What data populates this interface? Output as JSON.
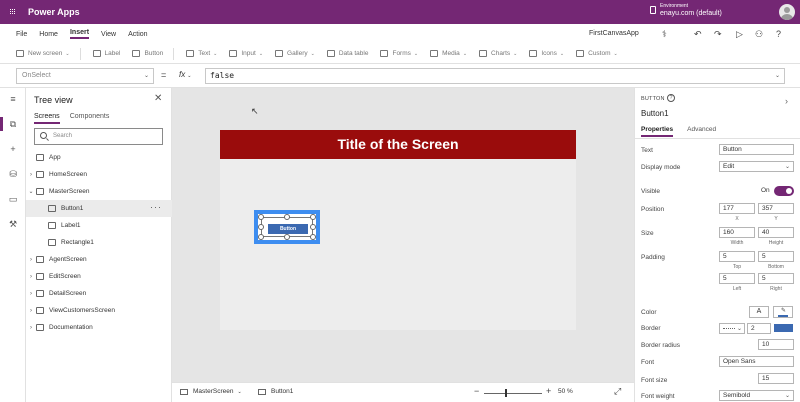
{
  "app": {
    "title": "Power Apps",
    "environment_label": "Environment",
    "environment_value": "enayu.com (default)"
  },
  "menu": {
    "items": [
      "File",
      "Home",
      "Insert",
      "View",
      "Action"
    ],
    "active": "Insert",
    "app_name": "FirstCanvasApp"
  },
  "ribbon": {
    "new_screen": "New screen",
    "label": "Label",
    "button": "Button",
    "text": "Text",
    "input": "Input",
    "gallery": "Gallery",
    "data_table": "Data table",
    "forms": "Forms",
    "media": "Media",
    "charts": "Charts",
    "icons": "Icons",
    "custom": "Custom"
  },
  "formula": {
    "property": "OnSelect",
    "equals": "=",
    "fx": "fx",
    "value": "false"
  },
  "tree": {
    "title": "Tree view",
    "tabs": [
      "Screens",
      "Components"
    ],
    "search_placeholder": "Search",
    "app": "App",
    "home_screen": "HomeScreen",
    "master_screen": "MasterScreen",
    "button1": "Button1",
    "label1": "Label1",
    "rectangle1": "Rectangle1",
    "agent_screen": "AgentScreen",
    "edit_screen": "EditScreen",
    "detail_screen": "DetailScreen",
    "view_customers_screen": "ViewCustomersScreen",
    "documentation": "Documentation"
  },
  "canvas": {
    "screen_title": "Title of the Screen",
    "button_text": "Button"
  },
  "statusbar": {
    "screen": "MasterScreen",
    "control": "Button1",
    "zoom_minus": "−",
    "zoom_plus": "+",
    "zoom": "50 %",
    "zoom_fraction": 0.5
  },
  "properties": {
    "type": "BUTTON",
    "name": "Button1",
    "tabs": [
      "Properties",
      "Advanced"
    ],
    "text_label": "Text",
    "text_value": "Button",
    "display_mode_label": "Display mode",
    "display_mode_value": "Edit",
    "visible_label": "Visible",
    "visible_value": "On",
    "position_label": "Position",
    "x": "177",
    "y": "357",
    "x_label": "X",
    "y_label": "Y",
    "size_label": "Size",
    "width": "160",
    "height": "40",
    "width_label": "Width",
    "height_label": "Height",
    "padding_label": "Padding",
    "pad_top": "5",
    "pad_bottom": "5",
    "pad_left": "5",
    "pad_right": "5",
    "top_label": "Top",
    "bottom_label": "Bottom",
    "left_label": "Left",
    "right_label": "Right",
    "color_label": "Color",
    "color_a": "A",
    "border_label": "Border",
    "border_width": "2",
    "border_color": "#3b69b1",
    "border_radius_label": "Border radius",
    "border_radius": "10",
    "font_label": "Font",
    "font_value": "Open Sans",
    "font_size_label": "Font size",
    "font_size_value": "15",
    "font_weight_label": "Font weight",
    "font_weight_value": "Semibold"
  },
  "colors": {
    "brand": "#742774",
    "title_bar": "#9a0c0c",
    "selection": "#3d8df0",
    "button": "#3b69b1"
  }
}
